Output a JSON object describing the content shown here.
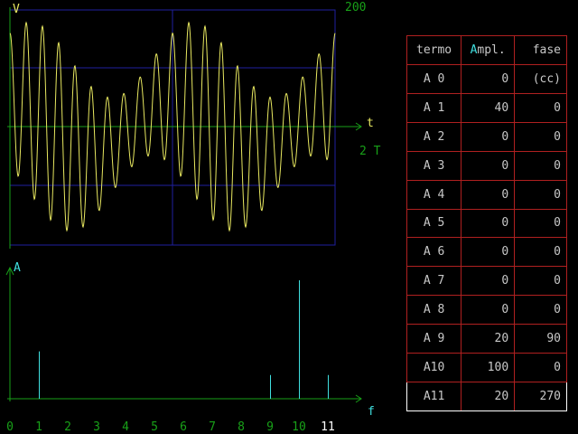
{
  "time_plot": {
    "y_label": "V",
    "scale_label": "200",
    "x_label": "t",
    "period_label": "2 T"
  },
  "spectrum_plot": {
    "y_label": "A",
    "x_label": "f",
    "tick_labels": [
      "0",
      "1",
      "2",
      "3",
      "4",
      "5",
      "6",
      "7",
      "8",
      "9",
      "10",
      "11"
    ],
    "selected_tick": "11"
  },
  "table": {
    "headers": {
      "term": "termo",
      "ampl_prefix": "A",
      "ampl_suffix": "mpl.",
      "phase": "fase"
    },
    "rows": [
      {
        "term": "A 0",
        "ampl": "0",
        "phase": "(cc)"
      },
      {
        "term": "A 1",
        "ampl": "40",
        "phase": "0"
      },
      {
        "term": "A 2",
        "ampl": "0",
        "phase": "0"
      },
      {
        "term": "A 3",
        "ampl": "0",
        "phase": "0"
      },
      {
        "term": "A 4",
        "ampl": "0",
        "phase": "0"
      },
      {
        "term": "A 5",
        "ampl": "0",
        "phase": "0"
      },
      {
        "term": "A 6",
        "ampl": "0",
        "phase": "0"
      },
      {
        "term": "A 7",
        "ampl": "0",
        "phase": "0"
      },
      {
        "term": "A 8",
        "ampl": "0",
        "phase": "0"
      },
      {
        "term": "A 9",
        "ampl": "20",
        "phase": "90"
      },
      {
        "term": "A10",
        "ampl": "100",
        "phase": "0"
      },
      {
        "term": "A11",
        "ampl": "20",
        "phase": "270"
      }
    ],
    "selected_row": 11
  },
  "colors": {
    "axis": "#18a018",
    "grid": "#2020a0",
    "wave": "#e8e860",
    "spectrum": "#40e0e0",
    "border": "#b02020",
    "text": "#c8c8c8"
  }
}
